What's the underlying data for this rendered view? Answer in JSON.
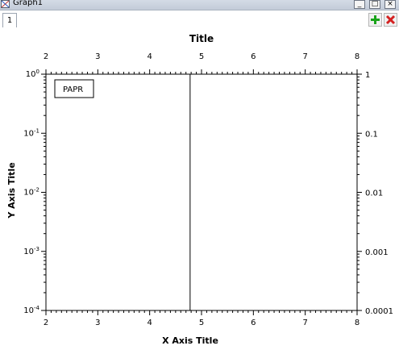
{
  "window": {
    "title": "Graph1",
    "page_tab": "1"
  },
  "buttons": {
    "minimize": "_",
    "maximize": "□",
    "close": "×"
  },
  "toolbar": {
    "add_icon": "plus-icon",
    "remove_icon": "x-icon",
    "add_color": "#1aa31a",
    "remove_color": "#d42020"
  },
  "legend": {
    "text": "PAPR"
  },
  "chart_data": {
    "type": "line",
    "title": "Title",
    "xlabel": "X Axis Title",
    "ylabel": "Y Axis Title",
    "xlim": [
      2,
      8
    ],
    "ylim": [
      0.0001,
      1
    ],
    "yscale": "log",
    "x_ticks": [
      2,
      3,
      4,
      5,
      6,
      7,
      8
    ],
    "y_left_ticks": [
      {
        "value": 1,
        "base": "10",
        "exp": "0"
      },
      {
        "value": 0.1,
        "base": "10",
        "exp": "-1"
      },
      {
        "value": 0.01,
        "base": "10",
        "exp": "-2"
      },
      {
        "value": 0.001,
        "base": "10",
        "exp": "-3"
      },
      {
        "value": 0.0001,
        "base": "10",
        "exp": "-4"
      }
    ],
    "y_right_ticks": [
      {
        "value": 1,
        "label": "1"
      },
      {
        "value": 0.1,
        "label": "0.1"
      },
      {
        "value": 0.01,
        "label": "0.01"
      },
      {
        "value": 0.001,
        "label": "0.001"
      },
      {
        "value": 0.0001,
        "label": "0.0001"
      }
    ],
    "series": [
      {
        "x": [
          4.78,
          4.78
        ],
        "y": [
          0.0001,
          1
        ],
        "color": "#000000"
      }
    ],
    "grid": false,
    "legend_position": "top-left"
  }
}
